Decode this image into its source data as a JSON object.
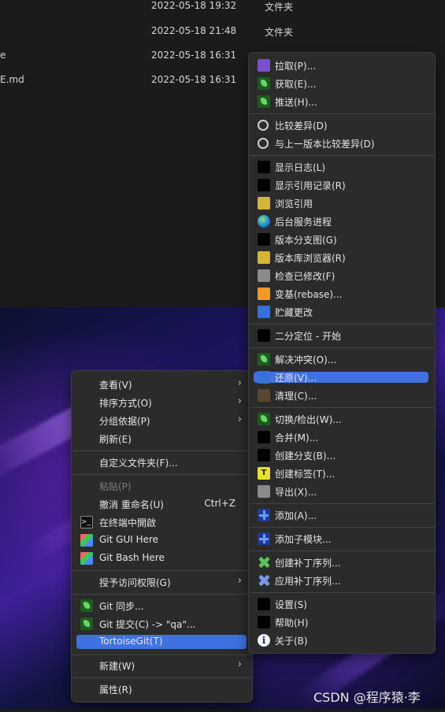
{
  "files": [
    {
      "name": "",
      "date": "2022-05-18 19:32",
      "type": "文件夹"
    },
    {
      "name": "",
      "date": "2022-05-18 21:48",
      "type": "文件夹"
    },
    {
      "name": "e",
      "date": "2022-05-18 16:31",
      "type": ""
    },
    {
      "name": "E.md",
      "date": "2022-05-18 16:31",
      "type": ""
    }
  ],
  "context_menu": {
    "view": "查看(V)",
    "sort": "排序方式(O)",
    "group": "分组依据(P)",
    "refresh": "刷新(E)",
    "customize": "自定义文件夹(F)...",
    "paste": "粘贴(P)",
    "undo": "撤消 重命名(U)",
    "undo_shortcut": "Ctrl+Z",
    "terminal": "在终端中開啟",
    "git_gui": "Git GUI Here",
    "git_bash": "Git Bash Here",
    "grant_access": "授予访问权限(G)",
    "git_sync": "Git 同步...",
    "git_commit": "Git 提交(C) -> \"qa\"...",
    "tortoisegit": "TortoiseGit(T)",
    "new": "新建(W)",
    "properties": "属性(R)"
  },
  "tortoise_menu": {
    "pull": "拉取(P)...",
    "fetch": "获取(E)...",
    "push": "推送(H)...",
    "diff": "比较差异(D)",
    "diff_prev": "与上一版本比较差异(D)",
    "show_log": "显示日志(L)",
    "show_reflog": "显示引用记录(R)",
    "browse_refs": "浏览引用",
    "daemon": "后台服务进程",
    "revision_graph": "版本分支图(G)",
    "repo_browser": "版本库浏览器(R)",
    "check_modifications": "检查已修改(F)",
    "rebase": "变基(rebase)...",
    "stash": "贮藏更改",
    "bisect": "二分定位 - 开始",
    "resolve": "解决冲突(O)...",
    "revert": "还原(V)...",
    "cleanup": "清理(C)...",
    "switch": "切换/检出(W)...",
    "merge": "合并(M)...",
    "create_branch": "创建分支(B)...",
    "create_tag": "创建标签(T)...",
    "export": "导出(X)...",
    "add": "添加(A)...",
    "add_submodule": "添加子模块...",
    "create_patch": "创建补丁序列...",
    "apply_patch": "应用补丁序列...",
    "settings": "设置(S)",
    "help": "帮助(H)",
    "about": "关于(B)"
  },
  "watermark": "CSDN @程序猿·李",
  "colors": {
    "menu_bg": "#2b2b2b",
    "highlight": "#3f72e0",
    "explorer_bg": "#1b1b1b"
  }
}
